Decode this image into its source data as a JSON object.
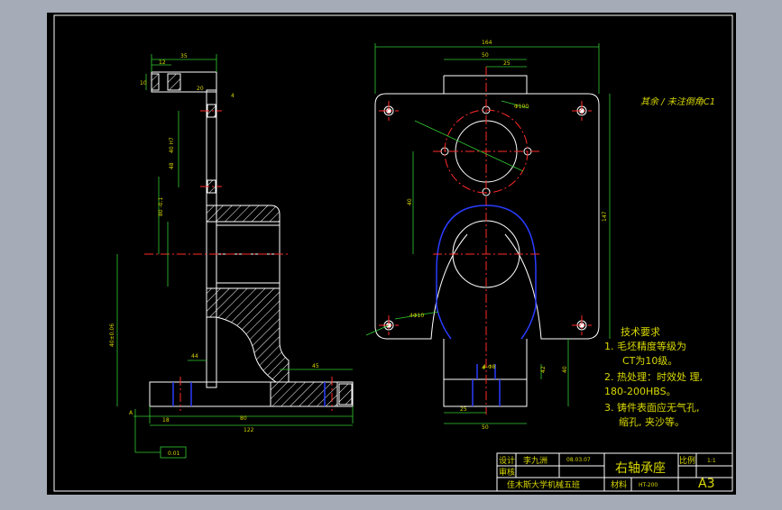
{
  "colors": {
    "background": "#a5acb7",
    "paper": "#000000",
    "line": "#ffffff",
    "dim": "#33cc33",
    "center": "#ff2a2a",
    "hidden": "#2a3cff",
    "note": "#d8d800",
    "title_text": "#d8d800"
  },
  "side_view": {
    "dims": [
      "12",
      "35",
      "10",
      "4",
      "20",
      "40 H7",
      "48",
      "80 -0.1",
      "44",
      "45",
      "18",
      "80",
      "122",
      "40±0.06"
    ],
    "flatness": "0.01",
    "datum": "A"
  },
  "front_view": {
    "dims": [
      "164",
      "50",
      "25",
      "40",
      "60",
      "147",
      "50",
      "4",
      "40",
      "25",
      "50",
      "30",
      "42"
    ],
    "hole_labels": [
      "Φ100",
      "4Φ10",
      "4-Φ8"
    ]
  },
  "roughness_note": "其余 / 未注倒角C1",
  "tech_requirements": {
    "title": "技术要求",
    "items": [
      "1. 毛坯精度等级为",
      "    CT为10级。",
      "2. 热处理：时效处 理,",
      "180-200HBS。",
      "3. 铸件表面应无气孔,",
      "缩孔, 夹沙等。"
    ]
  },
  "title_block": {
    "designer_label": "设计",
    "designer_name": "李九洲",
    "date": "08.03.07",
    "checker_label": "审核",
    "part_name": "右轴承座",
    "scale_label": "比例",
    "scale_value": "1:1",
    "school": "佳木斯大学机械五班",
    "material_label": "材料",
    "material": "HT-200",
    "sheet_size": "A3"
  }
}
